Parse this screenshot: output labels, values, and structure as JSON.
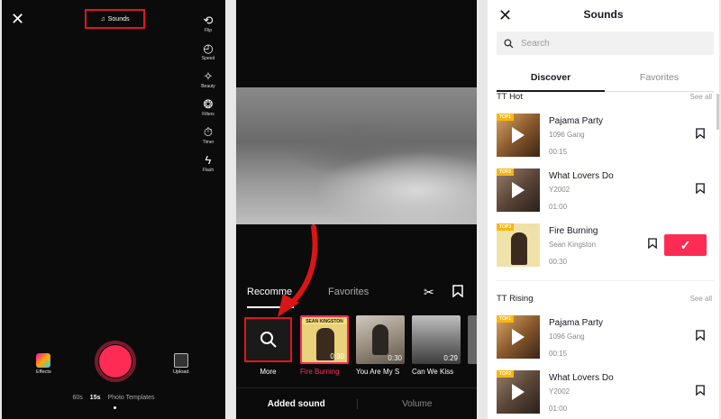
{
  "camera": {
    "close_icon": "✕",
    "sounds_label": "Sounds",
    "tools": [
      {
        "label": "Flip",
        "icon": "flip-icon",
        "glyph": "⟲"
      },
      {
        "label": "Speed",
        "icon": "speed-icon",
        "glyph": "◴"
      },
      {
        "label": "Beauty",
        "icon": "beauty-icon",
        "glyph": "✧"
      },
      {
        "label": "Filters",
        "icon": "filters-icon",
        "glyph": "❂"
      },
      {
        "label": "Timer",
        "icon": "timer-icon",
        "glyph": "⏱"
      },
      {
        "label": "Flash",
        "icon": "flash-icon",
        "glyph": "ϟ"
      }
    ],
    "effects_label": "Effects",
    "upload_label": "Upload",
    "modes": [
      "60s",
      "15s",
      "Photo Templates"
    ],
    "active_mode": "15s",
    "record_color": "#fe2c55"
  },
  "editor": {
    "tabs": {
      "recommended": "Recomme",
      "favorites": "Favorites"
    },
    "more_label": "More",
    "thumbs": [
      {
        "title": "Fire Burning",
        "duration": "0:30",
        "selected": true,
        "accent": "#fe2c55",
        "art_text": "SEAN KINGSTON"
      },
      {
        "title": "You Are My S",
        "duration": "0:30",
        "selected": false
      },
      {
        "title": "Can We Kiss",
        "duration": "0:29",
        "selected": false
      }
    ],
    "bottom": {
      "added": "Added sound",
      "volume": "Volume"
    }
  },
  "sounds": {
    "close_icon": "✕",
    "title": "Sounds",
    "search_placeholder": "Search",
    "tabs": {
      "discover": "Discover",
      "favorites": "Favorites"
    },
    "sections": [
      {
        "title": "TT Hot",
        "see_all": "See all",
        "songs": [
          {
            "rank": "TOP1",
            "name": "Pajama Party",
            "artist": "1096 Gang",
            "duration": "00:15",
            "selected": false
          },
          {
            "rank": "TOP2",
            "name": "What Lovers Do",
            "artist": "Y2002",
            "duration": "01:00",
            "selected": false
          },
          {
            "rank": "TOP3",
            "name": "Fire Burning",
            "artist": "Sean Kingston",
            "duration": "00:30",
            "selected": true
          }
        ]
      },
      {
        "title": "TT Rising",
        "see_all": "See all",
        "songs": [
          {
            "rank": "TOP1",
            "name": "Pajama Party",
            "artist": "1096 Gang",
            "duration": "00:15",
            "selected": false
          },
          {
            "rank": "TOP2",
            "name": "What Lovers Do",
            "artist": "Y2002",
            "duration": "01:00",
            "selected": false
          }
        ]
      }
    ],
    "accent": "#fe2c55"
  }
}
